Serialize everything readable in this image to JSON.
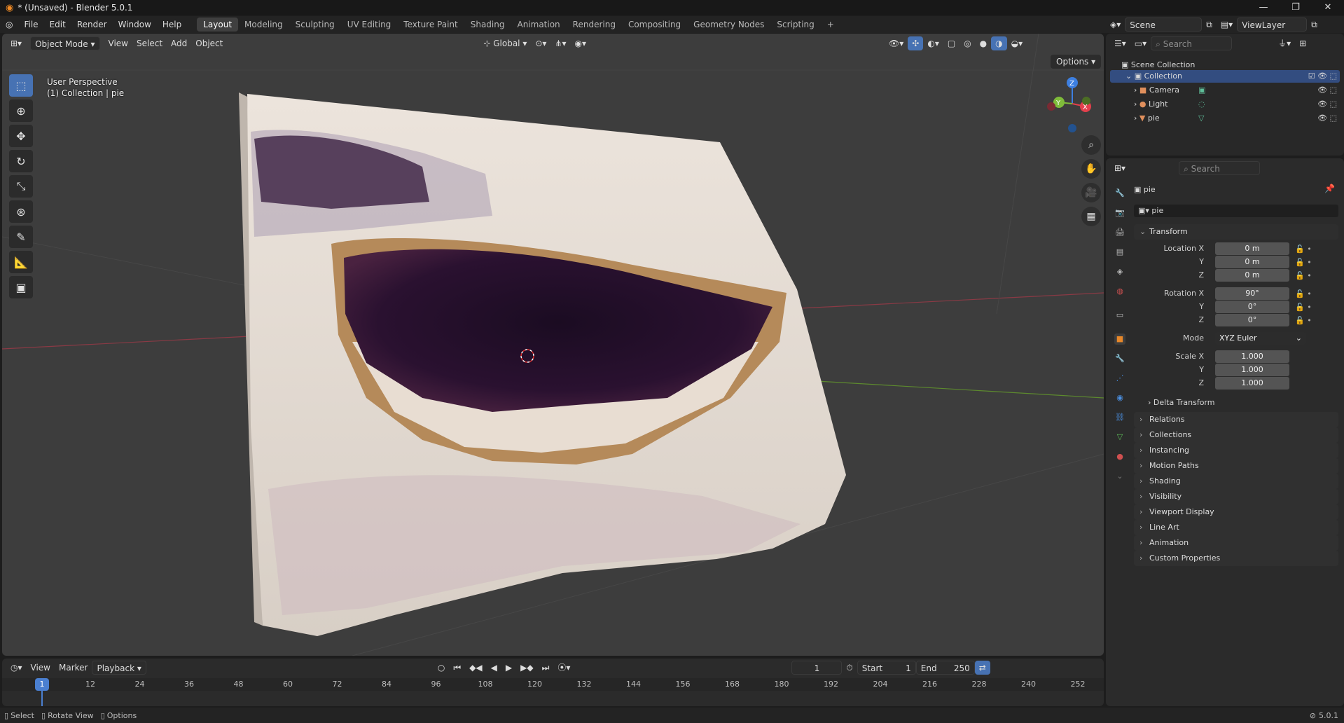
{
  "window": {
    "title": "* (Unsaved) - Blender 5.0.1",
    "min": "—",
    "max": "❐",
    "close": "✕"
  },
  "menu": {
    "items": [
      "File",
      "Edit",
      "Render",
      "Window",
      "Help"
    ],
    "workspaces": [
      "Layout",
      "Modeling",
      "Sculpting",
      "UV Editing",
      "Texture Paint",
      "Shading",
      "Animation",
      "Rendering",
      "Compositing",
      "Geometry Nodes",
      "Scripting"
    ],
    "active_workspace": "Layout",
    "add": "+"
  },
  "viewport": {
    "mode": "Object Mode",
    "menus": [
      "View",
      "Select",
      "Add",
      "Object"
    ],
    "orientation": "Global",
    "options": "Options",
    "overlay_line1": "User Perspective",
    "overlay_line2": "(1) Collection | pie",
    "gizmo": {
      "x": "X",
      "y": "Y",
      "z": "Z"
    }
  },
  "outliner": {
    "scene_label": "Scene",
    "viewlayer_label": "ViewLayer",
    "search_placeholder": "Search",
    "root": "Scene Collection",
    "collection": "Collection",
    "objects": [
      "Camera",
      "Light",
      "pie"
    ]
  },
  "properties": {
    "search_placeholder": "Search",
    "object_name": "pie",
    "data_name": "pie",
    "transform": {
      "title": "Transform",
      "location_label": "Location X",
      "y_label": "Y",
      "z_label": "Z",
      "loc": [
        "0 m",
        "0 m",
        "0 m"
      ],
      "rotation_label": "Rotation X",
      "rot": [
        "90°",
        "0°",
        "0°"
      ],
      "mode_label": "Mode",
      "mode": "XYZ Euler",
      "scale_label": "Scale X",
      "scale": [
        "1.000",
        "1.000",
        "1.000"
      ]
    },
    "delta": "Delta Transform",
    "panels": [
      "Relations",
      "Collections",
      "Instancing",
      "Motion Paths",
      "Shading",
      "Visibility",
      "Viewport Display",
      "Line Art",
      "Animation",
      "Custom Properties"
    ]
  },
  "timeline": {
    "menus": [
      "View",
      "Marker"
    ],
    "playback": "Playback",
    "current_frame": "1",
    "start_label": "Start",
    "start": "1",
    "end_label": "End",
    "end": "250",
    "ticks": [
      "12",
      "24",
      "36",
      "48",
      "60",
      "72",
      "84",
      "96",
      "108",
      "120",
      "132",
      "144",
      "156",
      "168",
      "180",
      "192",
      "204",
      "216",
      "228",
      "240",
      "252"
    ],
    "playhead": "1"
  },
  "status": {
    "select": "Select",
    "rotate": "Rotate View",
    "options": "Options",
    "version": "5.0.1"
  },
  "colors": {
    "accent": "#4772b3",
    "x_axis": "#e2404c",
    "y_axis": "#7fbb3a",
    "z_axis": "#3d7fe0",
    "playhead": "#4a7fd0"
  }
}
